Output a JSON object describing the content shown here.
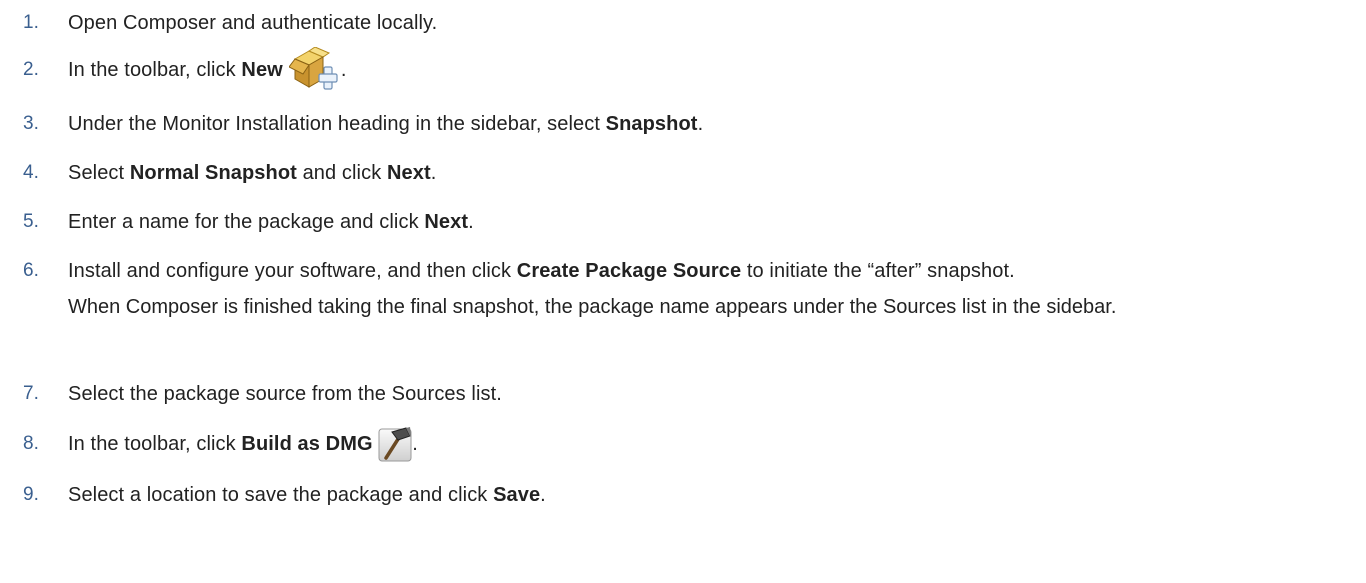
{
  "steps": [
    {
      "num": "1.",
      "parts": [
        {
          "t": "Open Composer and authenticate locally.",
          "b": false
        }
      ]
    },
    {
      "num": "2.",
      "parts": [
        {
          "t": "In the toolbar, click ",
          "b": false
        },
        {
          "t": "New",
          "b": true
        }
      ],
      "icon": "new-package-icon",
      "after": "."
    },
    {
      "num": "3.",
      "parts": [
        {
          "t": "Under the Monitor Installation heading in the sidebar, select ",
          "b": false
        },
        {
          "t": "Snapshot",
          "b": true
        },
        {
          "t": ".",
          "b": false
        }
      ]
    },
    {
      "num": "4.",
      "parts": [
        {
          "t": "Select ",
          "b": false
        },
        {
          "t": "Normal Snapshot",
          "b": true
        },
        {
          "t": " and click ",
          "b": false
        },
        {
          "t": "Next",
          "b": true
        },
        {
          "t": ".",
          "b": false
        }
      ]
    },
    {
      "num": "5.",
      "parts": [
        {
          "t": "Enter a name for the package and click ",
          "b": false
        },
        {
          "t": "Next",
          "b": true
        },
        {
          "t": ".",
          "b": false
        }
      ]
    },
    {
      "num": "6.",
      "parts": [
        {
          "t": "Install and configure your software, and then click ",
          "b": false
        },
        {
          "t": "Create Package Source",
          "b": true
        },
        {
          "t": " to initiate the “after” snapshot.",
          "b": false
        }
      ],
      "note": "When Composer is finished taking the final snapshot, the package name appears under the Sources list in the sidebar."
    },
    {
      "num": "7.",
      "parts": [
        {
          "t": "Select the package source from the Sources list.",
          "b": false
        }
      ]
    },
    {
      "num": "8.",
      "parts": [
        {
          "t": "In the toolbar, click ",
          "b": false
        },
        {
          "t": "Build as DMG",
          "b": true
        },
        {
          "t": " ",
          "b": false
        }
      ],
      "icon": "build-dmg-icon",
      "after": "."
    },
    {
      "num": "9.",
      "parts": [
        {
          "t": "Select a location to save the package and click ",
          "b": false
        },
        {
          "t": "Save",
          "b": true
        },
        {
          "t": ".",
          "b": false
        }
      ]
    }
  ],
  "colors": {
    "number": "#3a5f8f",
    "text": "#222222"
  }
}
